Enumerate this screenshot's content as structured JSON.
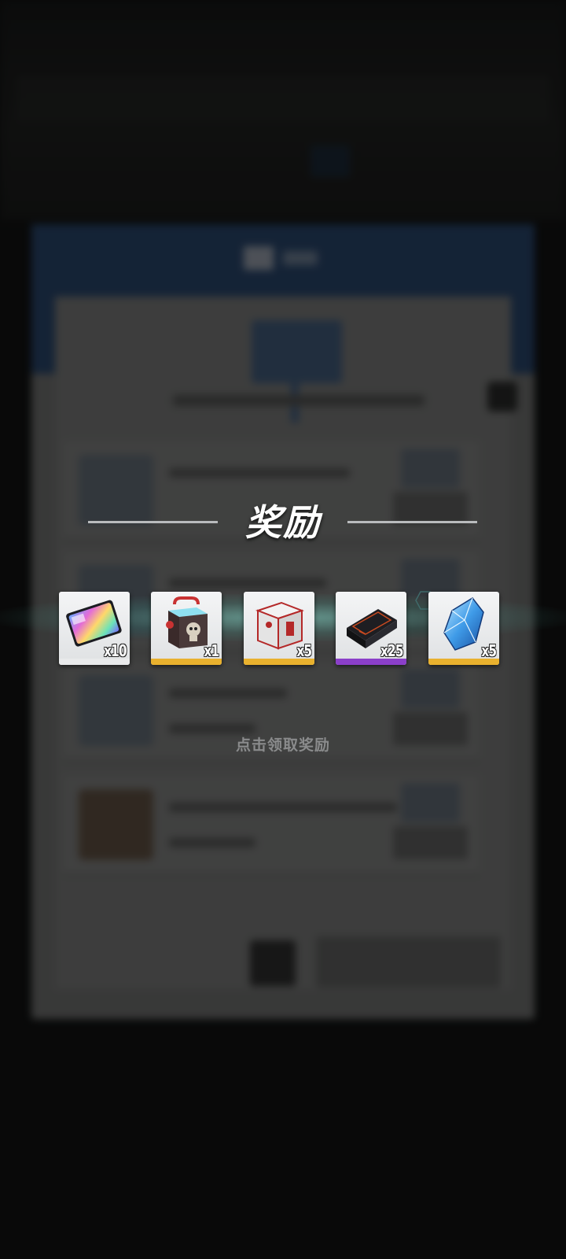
{
  "title": "奖励",
  "tap_hint": "点击领取奖励",
  "rewards": [
    {
      "icon": "holographic-card-icon",
      "quantity": "x10",
      "rarity": "none",
      "rarity_color": "#e9eaeb"
    },
    {
      "icon": "skull-box-icon",
      "quantity": "x1",
      "rarity": "gold",
      "rarity_color": "#e9b12e"
    },
    {
      "icon": "white-crate-icon",
      "quantity": "x5",
      "rarity": "gold",
      "rarity_color": "#e9b12e"
    },
    {
      "icon": "black-case-icon",
      "quantity": "x25",
      "rarity": "purple",
      "rarity_color": "#8b3fc9"
    },
    {
      "icon": "blue-crystal-icon",
      "quantity": "x5",
      "rarity": "gold",
      "rarity_color": "#e9b12e"
    }
  ]
}
